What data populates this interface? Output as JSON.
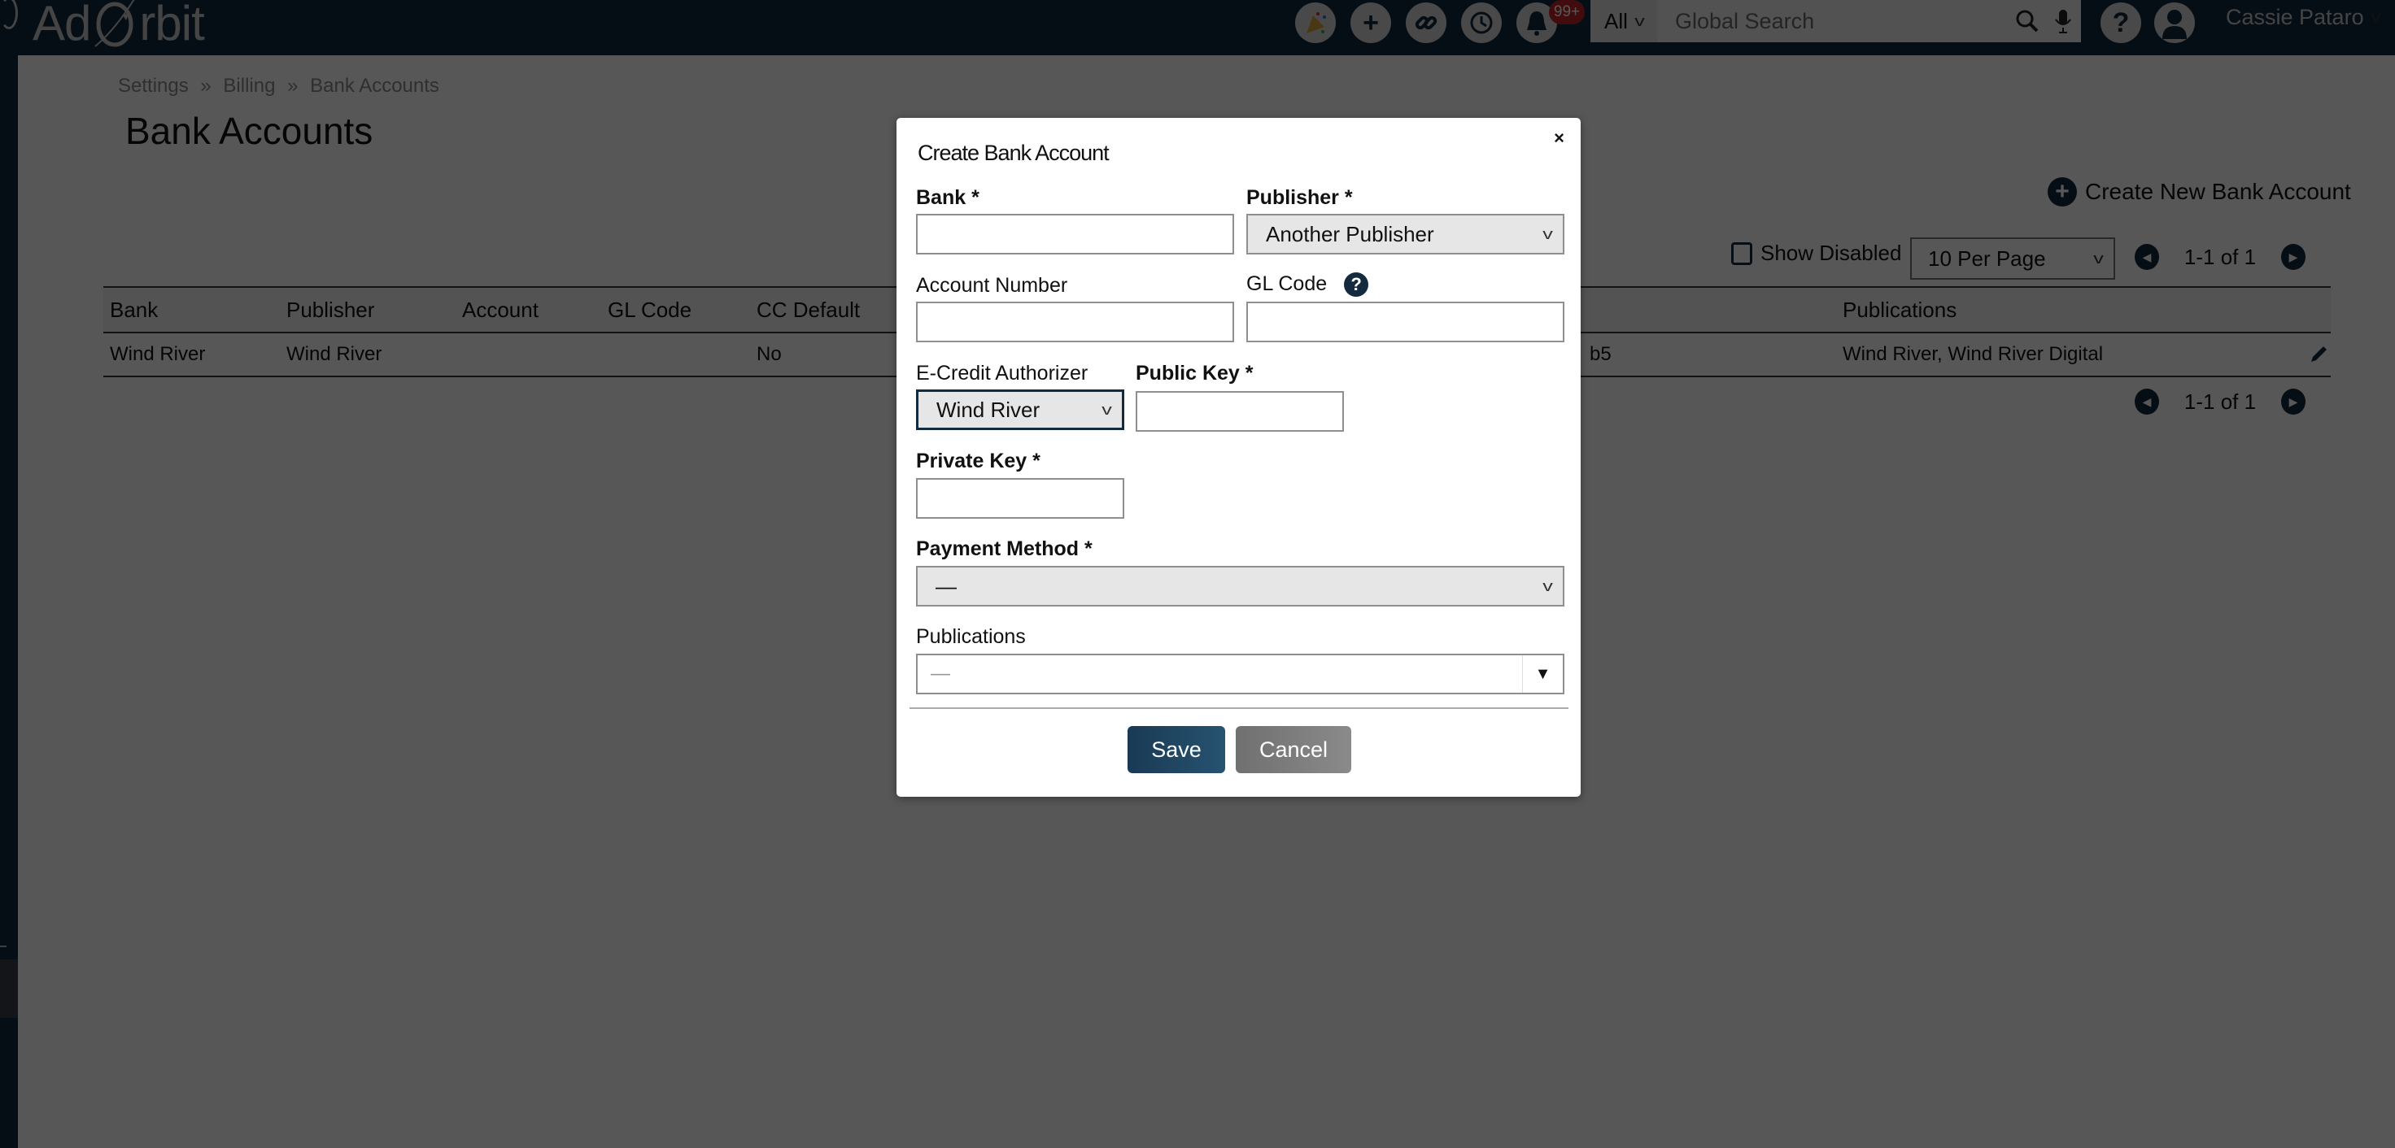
{
  "header": {
    "logo_text_1": "Ad",
    "logo_text_2": "rbit",
    "icons": [
      "party-popper-icon",
      "plus-icon",
      "link-icon",
      "history-icon",
      "bell-icon"
    ],
    "notification_badge": "99+",
    "search": {
      "scope": "All",
      "placeholder": "Global Search"
    },
    "user_name": "Cassie Pataro"
  },
  "page": {
    "breadcrumb": [
      "Settings",
      "»",
      "Billing",
      "»",
      "Bank Accounts"
    ],
    "title": "Bank Accounts",
    "create_label": "Create New Bank Account",
    "show_disabled_label": "Show Disabled",
    "per_page": "10 Per Page",
    "pagination_top": "1-1 of 1",
    "pagination_bottom": "1-1 of 1"
  },
  "table": {
    "headers": [
      "Bank",
      "Publisher",
      "Account",
      "GL Code",
      "CC Default",
      "Publications"
    ],
    "rows": [
      {
        "bank": "Wind River",
        "publisher": "Wind River",
        "account": "",
        "gl_code": "",
        "cc_default": "No",
        "partial_hidden": "b5",
        "publications": "Wind River, Wind River Digital"
      }
    ]
  },
  "modal": {
    "title": "Create Bank Account",
    "close": "×",
    "bank_label": "Bank *",
    "bank_value": "",
    "publisher_label": "Publisher *",
    "publisher_value": "Another Publisher",
    "account_number_label": "Account Number",
    "account_number_value": "",
    "gl_code_label": "GL Code",
    "gl_code_value": "",
    "help": "?",
    "ecredit_label": "E-Credit Authorizer",
    "ecredit_value": "Wind River",
    "public_key_label": "Public Key *",
    "public_key_value": "",
    "private_key_label": "Private Key *",
    "private_key_value": "",
    "payment_method_label": "Payment Method *",
    "payment_method_value": "—",
    "publications_label": "Publications",
    "publications_value": "—",
    "save_label": "Save",
    "cancel_label": "Cancel"
  }
}
